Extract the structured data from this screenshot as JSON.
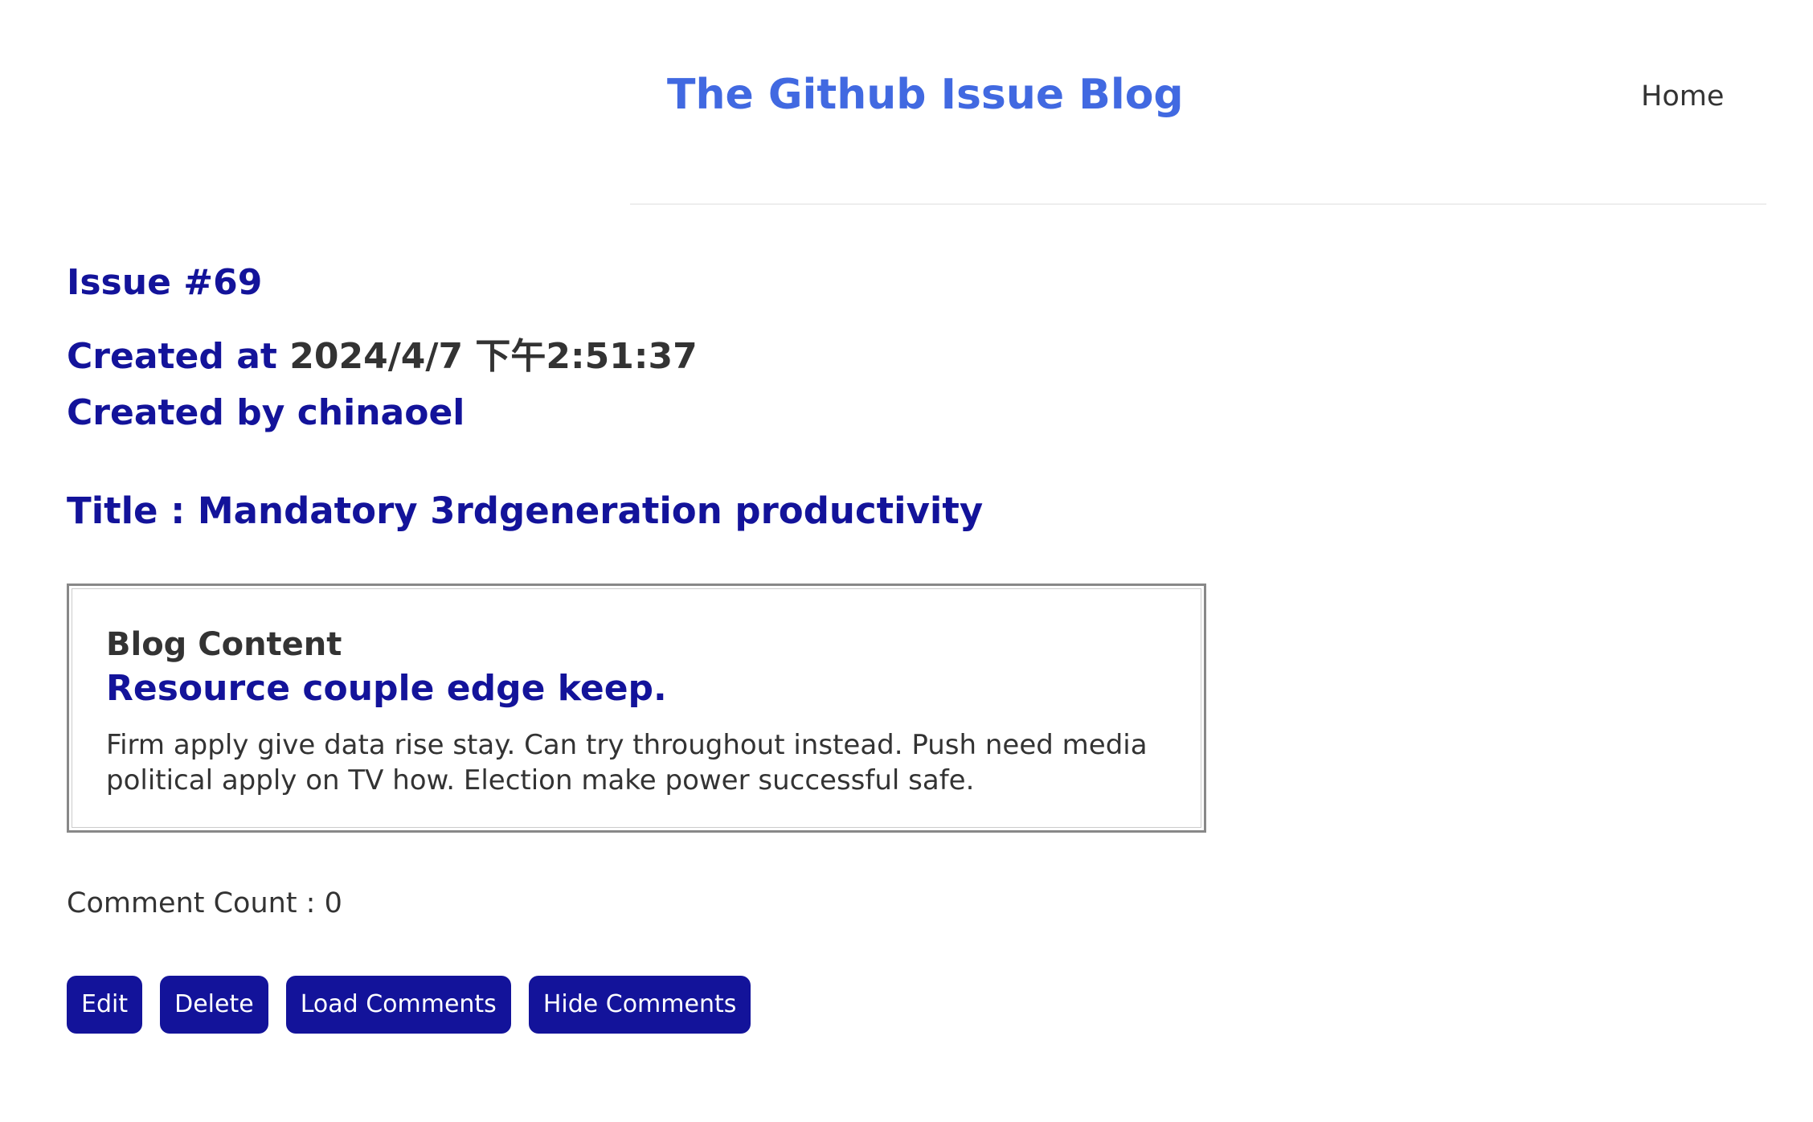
{
  "header": {
    "site_title": "The Github Issue Blog",
    "nav_home": "Home"
  },
  "issue": {
    "number_label": "Issue #69",
    "created_at_label": "Created at ",
    "created_at_value": "2024/4/7 下午2:51:37",
    "created_by_label": "Created by chinaoel",
    "title_label": "Title : Mandatory 3rdgeneration productivity"
  },
  "content": {
    "section_label": "Blog Content",
    "heading": "Resource couple edge keep.",
    "body": "Firm apply give data rise stay. Can try throughout instead. Push need media political apply on TV how. Election make power successful safe."
  },
  "comments": {
    "count_label": "Comment Count : 0"
  },
  "actions": {
    "edit": "Edit",
    "delete": "Delete",
    "load_comments": "Load Comments",
    "hide_comments": "Hide Comments"
  },
  "colors": {
    "title_blue": "#4169e1",
    "navy": "#13139a",
    "text": "#333333"
  }
}
